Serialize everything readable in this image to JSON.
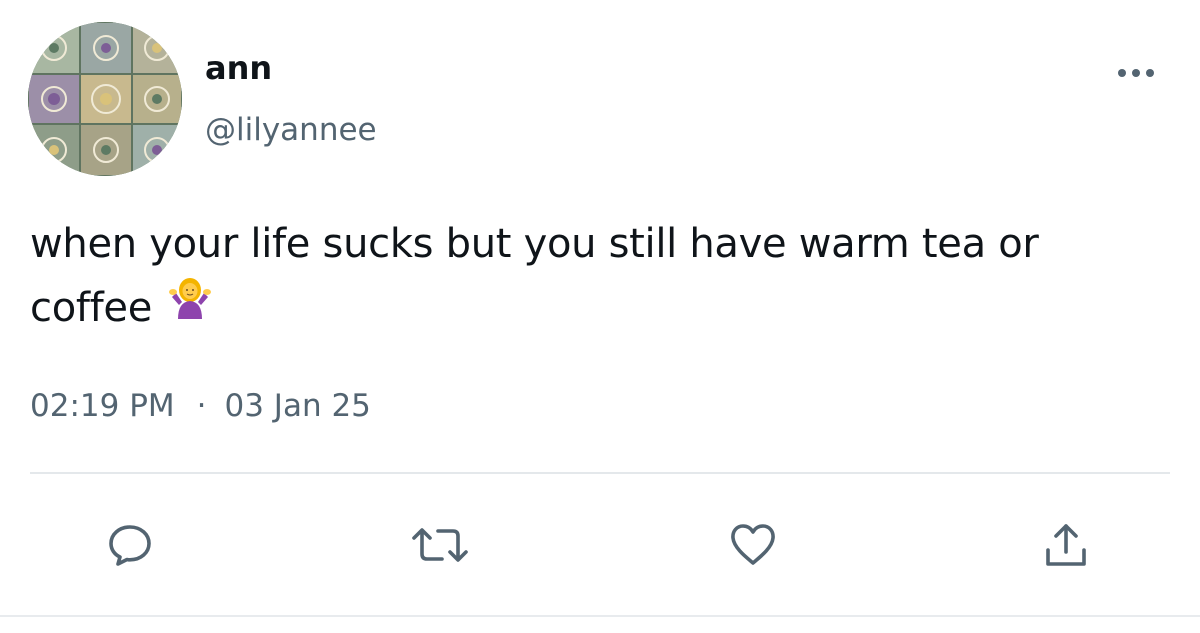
{
  "author": {
    "display_name": "ann",
    "handle": "@lilyannee"
  },
  "tweet": {
    "text": "when your life sucks but you still have warm tea or coffee",
    "emoji": "person-shrugging-emoji",
    "time": "02:19 PM",
    "separator": "·",
    "date": "03 Jan 25"
  },
  "icons": {
    "more": "more-horizontal-icon",
    "reply": "reply-icon",
    "retweet": "retweet-icon",
    "like": "heart-icon",
    "share": "share-icon"
  },
  "colors": {
    "text": "#0f1419",
    "secondary_text": "#536471",
    "icon": "#536471",
    "divider": "#e4e8eb",
    "emoji_shirt": "#8e44ad",
    "emoji_hair": "#f4b400"
  }
}
